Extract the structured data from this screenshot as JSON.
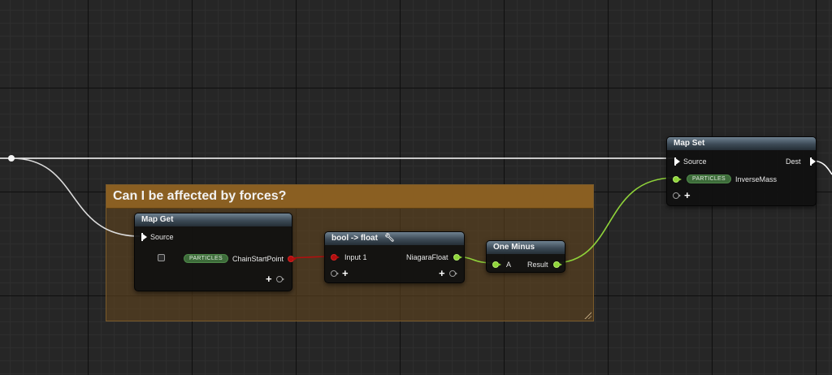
{
  "comment": {
    "title": "Can I be affected by forces?"
  },
  "nodes": {
    "map_get": {
      "title": "Map Get",
      "source_label": "Source",
      "namespace_badge": "PARTICLES",
      "attribute_label": "ChainStartPoint",
      "add_pin_label": "+"
    },
    "bool_to_float": {
      "title": "bool -> float",
      "title_icon": "wrench-icon",
      "input_label": "Input 1",
      "output_label": "NiagaraFloat",
      "add_pin_label": "+"
    },
    "one_minus": {
      "title": "One Minus",
      "input_label": "A",
      "output_label": "Result"
    },
    "map_set": {
      "title": "Map Set",
      "source_label": "Source",
      "dest_label": "Dest",
      "namespace_badge": "PARTICLES",
      "attribute_label": "InverseMass",
      "add_pin_label": "+"
    }
  },
  "colors": {
    "bool_pin": "#b30f0f",
    "float_pin": "#8fd33a",
    "exec_wire": "#ffffff",
    "comment_header": "#8a5f22",
    "node_header": "#3c4a56"
  }
}
